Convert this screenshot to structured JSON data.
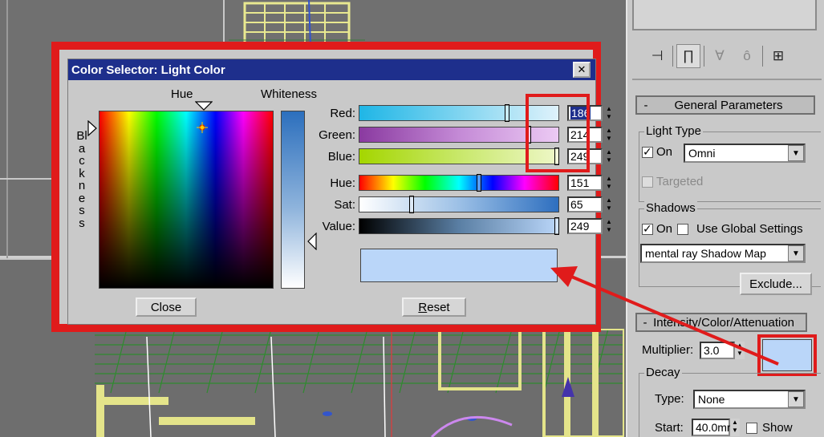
{
  "dialog": {
    "title": "Color Selector: Light Color",
    "close_glyph": "✕",
    "hue_label": "Hue",
    "whiteness_label": "Whiteness",
    "blackness_label": "Blackness",
    "close_button": "Close",
    "reset_button": "Reset",
    "rgb": [
      {
        "label": "Red:",
        "value": "186",
        "level": 0.73,
        "selected": true
      },
      {
        "label": "Green:",
        "value": "214",
        "level": 0.84
      },
      {
        "label": "Blue:",
        "value": "249",
        "level": 0.98
      }
    ],
    "hsv": [
      {
        "label": "Hue:",
        "value": "151",
        "level": 0.59
      },
      {
        "label": "Sat:",
        "value": "65",
        "level": 0.25
      },
      {
        "label": "Value:",
        "value": "249",
        "level": 0.98
      }
    ],
    "swatch_color": "#bad6f9"
  },
  "panel": {
    "general_parameters": {
      "minus": "-",
      "title": "General Parameters",
      "light_type_title": "Light Type",
      "on_label": "On",
      "light_type_value": "Omni",
      "targeted_label": "Targeted",
      "shadows_title": "Shadows",
      "shadows_on_label": "On",
      "use_global_label": "Use Global Settings",
      "shadow_map_value": "mental ray Shadow Map",
      "exclude_button": "Exclude..."
    },
    "intensity": {
      "minus": "-",
      "title": "Intensity/Color/Attenuation",
      "multiplier_label": "Multiplier:",
      "multiplier_value": "3.0",
      "color_swatch": "#bad6f9",
      "decay_title": "Decay",
      "type_label": "Type:",
      "type_value": "None",
      "start_label": "Start:",
      "start_value": "40.0mr",
      "show_label": "Show"
    },
    "tab_icons": [
      "pin-icon",
      "modify-icon",
      "fork-icon",
      "hand-icon",
      "settings-icon"
    ]
  },
  "colors": {
    "accent_red": "#e01b1b",
    "titlebar": "#1e2f8c"
  }
}
